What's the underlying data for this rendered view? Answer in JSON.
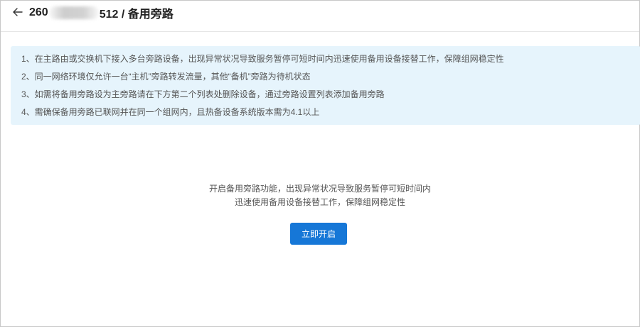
{
  "header": {
    "back_icon": "arrow-left-icon",
    "title_prefix": "260",
    "title_suffix": "512 / 备用旁路"
  },
  "notice": {
    "lines": [
      "1、在主路由或交换机下接入多台旁路设备，出现异常状况导致服务暂停可短时间内迅速使用备用设备接替工作，保障组网稳定性",
      "2、同一网络环境仅允许一台“主机”旁路转发流量，其他“备机”旁路为待机状态",
      "3、如需将备用旁路设为主旁路请在下方第二个列表处删除设备，通过旁路设置列表添加备用旁路",
      "4、需确保备用旁路已联网并在同一个组网内，且热备设备系统版本需为4.1以上"
    ],
    "background": "#e6f4fc"
  },
  "empty_state": {
    "line1": "开启备用旁路功能，出现异常状况导致服务暂停可短时间内",
    "line2": "迅速使用备用设备接替工作，保障组网稳定性",
    "button_label": "立即开启"
  },
  "colors": {
    "accent": "#1677d7"
  }
}
